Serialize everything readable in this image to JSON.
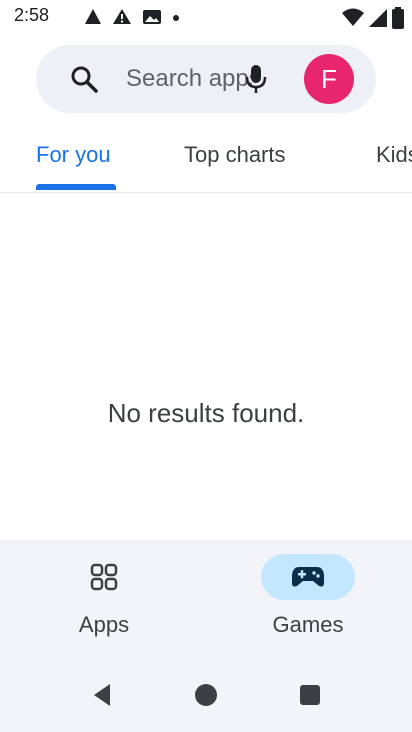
{
  "status_bar": {
    "time": "2:58"
  },
  "search": {
    "placeholder": "Search apps & games",
    "icon": "search-icon",
    "mic_icon": "mic-icon"
  },
  "account": {
    "initial": "F",
    "color": "#e8266d"
  },
  "tabs": [
    {
      "label": "For you",
      "selected": true
    },
    {
      "label": "Top charts",
      "selected": false
    },
    {
      "label": "Kids",
      "selected": false
    }
  ],
  "main": {
    "message": "No results found."
  },
  "bottom_nav": {
    "items": [
      {
        "label": "Apps",
        "icon": "apps-grid-icon",
        "selected": false
      },
      {
        "label": "Games",
        "icon": "gamepad-icon",
        "selected": true
      }
    ]
  },
  "colors": {
    "accent": "#1a73e8",
    "selected_nav_bg": "#c2e7ff",
    "search_bg": "#eef0f8"
  }
}
